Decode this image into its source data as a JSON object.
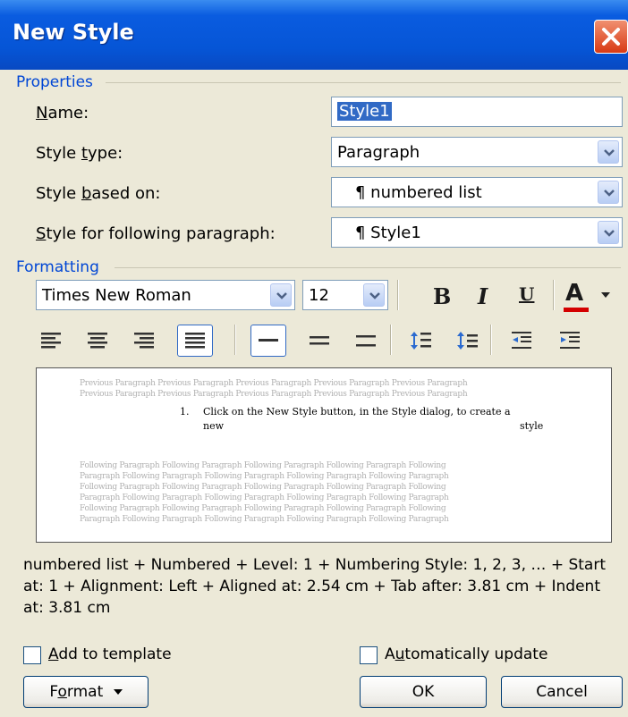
{
  "window": {
    "title": "New Style"
  },
  "properties": {
    "group_label": "Properties",
    "name_label_u": "N",
    "name_label_rest": "ame:",
    "name_value": "Style1",
    "type_label_a": "Style ",
    "type_label_u": "t",
    "type_label_b": "ype:",
    "type_value": "Paragraph",
    "based_label_a": "Style ",
    "based_label_u": "b",
    "based_label_b": "ased on:",
    "based_value": "¶ numbered list",
    "following_label_u": "S",
    "following_label_rest": "tyle for following paragraph:",
    "following_value": "¶ Style1"
  },
  "formatting": {
    "group_label": "Formatting",
    "font_value": "Times New Roman",
    "size_value": "12",
    "bold": "B",
    "italic": "I",
    "underline": "U",
    "font_color": "A",
    "color_accent": "#d40000"
  },
  "preview": {
    "before_line1": "Previous Paragraph Previous Paragraph Previous Paragraph Previous Paragraph Previous Paragraph",
    "before_line2": "Previous Paragraph Previous Paragraph Previous Paragraph Previous Paragraph Previous Paragraph",
    "item_number": "1.",
    "item_line1": "Click on the New Style button, in the Style dialog, to create a",
    "item_line2a": "new",
    "item_line2b": "style",
    "after_lines": [
      "Following Paragraph Following Paragraph Following Paragraph Following Paragraph Following",
      "Paragraph Following Paragraph Following Paragraph Following Paragraph Following Paragraph",
      "Following Paragraph Following Paragraph Following Paragraph Following Paragraph Following",
      "Paragraph Following Paragraph Following Paragraph Following Paragraph Following Paragraph",
      "Following Paragraph Following Paragraph Following Paragraph Following Paragraph Following",
      "Paragraph Following Paragraph Following Paragraph Following Paragraph Following Paragraph"
    ]
  },
  "description": "numbered list + Numbered + Level: 1 + Numbering Style: 1, 2, 3, … + Start at: 1 + Alignment: Left + Aligned at:  2.54 cm + Tab after:  3.81 cm + Indent at:  3.81 cm",
  "options": {
    "add_template_u": "A",
    "add_template_rest": "dd to template",
    "auto_update_a": "A",
    "auto_update_u": "u",
    "auto_update_b": "tomatically update"
  },
  "buttons": {
    "format_a": "F",
    "format_u": "o",
    "format_b": "rmat",
    "ok": "OK",
    "cancel": "Cancel"
  }
}
